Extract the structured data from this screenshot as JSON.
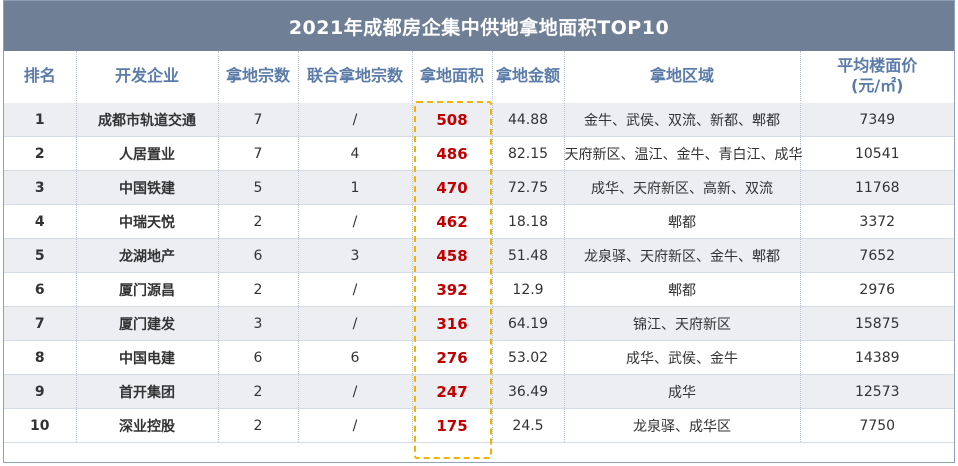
{
  "title": "2021年成都房企集中供地拿地面积TOP10",
  "columns": {
    "rank": "排名",
    "company": "开发企业",
    "count": "拿地宗数",
    "joint": "联合拿地宗数",
    "area": "拿地面积",
    "amount": "拿地金额",
    "region": "拿地区域",
    "price_line1": "平均楼面价",
    "price_line2": "(元/㎡)"
  },
  "rows": [
    {
      "rank": "1",
      "company": "成都市轨道交通",
      "count": "7",
      "joint": "/",
      "area": "508",
      "amount": "44.88",
      "region": "金牛、武侯、双流、新都、郫都",
      "price": "7349"
    },
    {
      "rank": "2",
      "company": "人居置业",
      "count": "7",
      "joint": "4",
      "area": "486",
      "amount": "82.15",
      "region": "天府新区、温江、金牛、青白江、成华",
      "price": "10541"
    },
    {
      "rank": "3",
      "company": "中国铁建",
      "count": "5",
      "joint": "1",
      "area": "470",
      "amount": "72.75",
      "region": "成华、天府新区、高新、双流",
      "price": "11768"
    },
    {
      "rank": "4",
      "company": "中瑞天悦",
      "count": "2",
      "joint": "/",
      "area": "462",
      "amount": "18.18",
      "region": "郫都",
      "price": "3372"
    },
    {
      "rank": "5",
      "company": "龙湖地产",
      "count": "6",
      "joint": "3",
      "area": "458",
      "amount": "51.48",
      "region": "龙泉驿、天府新区、金牛、郫都",
      "price": "7652"
    },
    {
      "rank": "6",
      "company": "厦门源昌",
      "count": "2",
      "joint": "/",
      "area": "392",
      "amount": "12.9",
      "region": "郫都",
      "price": "2976"
    },
    {
      "rank": "7",
      "company": "厦门建发",
      "count": "3",
      "joint": "/",
      "area": "316",
      "amount": "64.19",
      "region": "锦江、天府新区",
      "price": "15875"
    },
    {
      "rank": "8",
      "company": "中国电建",
      "count": "6",
      "joint": "6",
      "area": "276",
      "amount": "53.02",
      "region": "成华、武侯、金牛",
      "price": "14389"
    },
    {
      "rank": "9",
      "company": "首开集团",
      "count": "2",
      "joint": "/",
      "area": "247",
      "amount": "36.49",
      "region": "成华",
      "price": "12573"
    },
    {
      "rank": "10",
      "company": "深业控股",
      "count": "2",
      "joint": "/",
      "area": "175",
      "amount": "24.5",
      "region": "龙泉驿、成华区",
      "price": "7750"
    }
  ],
  "colors": {
    "title_bg": "#6f7f96",
    "header_text": "#5b7ba8",
    "area_text": "#c00000",
    "highlight_border": "#f0b400",
    "odd_row_bg": "#eceef2"
  }
}
